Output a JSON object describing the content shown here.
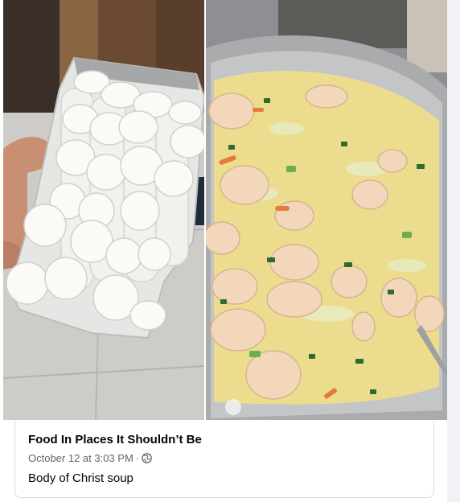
{
  "post": {
    "group_name": "Food In Places It Shouldn’t Be",
    "timestamp": "October 12 at 3:03 PM",
    "separator": "·",
    "audience_icon": "globe-icon",
    "text": "Body of Christ soup"
  },
  "photos": [
    {
      "subject": "bag-of-communion-wafers"
    },
    {
      "subject": "pot-of-sliced-fishcake-soup"
    }
  ],
  "colors": {
    "name_text": "#050505",
    "meta_text": "#65676b",
    "card_border": "#dadde1",
    "page_background": "#f0f2f5"
  }
}
